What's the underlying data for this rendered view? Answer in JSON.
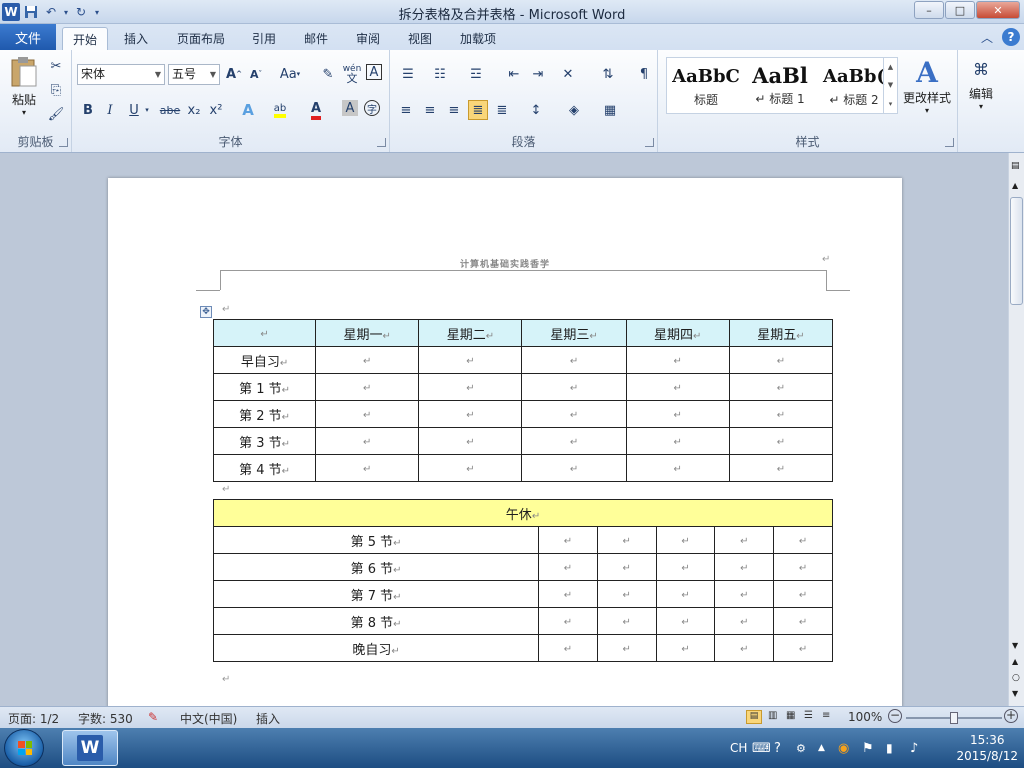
{
  "window": {
    "title": "拆分表格及合并表格 - Microsoft Word",
    "controls": {
      "minimize": "–",
      "maximize": "□",
      "close": "✕"
    }
  },
  "quick_access": {
    "app_icon": "W",
    "save_icon": "floppy-disk-icon",
    "undo_icon": "undo-icon",
    "redo_icon": "redo-icon"
  },
  "tabs": {
    "file": "文件",
    "items": [
      "开始",
      "插入",
      "页面布局",
      "引用",
      "邮件",
      "审阅",
      "视图",
      "加载项"
    ],
    "active": "开始"
  },
  "ribbon": {
    "clipboard": {
      "label": "剪贴板",
      "paste": "粘贴"
    },
    "font": {
      "label": "字体",
      "font_name": "宋体",
      "font_size": "五号",
      "aa_label": "Aa",
      "bold": "B",
      "italic": "I",
      "underline": "U",
      "strike": "abe",
      "subscript": "x₂",
      "superscript": "x²",
      "wen": "wén",
      "wen_char": "文",
      "a_box": "A",
      "zi": "字"
    },
    "paragraph": {
      "label": "段落"
    },
    "styles": {
      "label": "样式",
      "items": [
        {
          "sample": "AaBbC",
          "name": "标题"
        },
        {
          "sample": "AaBl",
          "name": "↵ 标题 1"
        },
        {
          "sample": "AaBb(",
          "name": "↵ 标题 2"
        }
      ],
      "change_styles": "更改样式"
    },
    "editing": {
      "label": "编辑"
    }
  },
  "document": {
    "header_text": "计算机基础实践香学",
    "return_mark": "↵",
    "table1": {
      "columns": [
        "",
        "星期一",
        "星期二",
        "星期三",
        "星期四",
        "星期五"
      ],
      "rows": [
        "早自习",
        "第 1 节",
        "第 2 节",
        "第 3 节",
        "第 4 节"
      ],
      "header_color": "#d6f3f9"
    },
    "table2": {
      "merged": "午休",
      "merged_color": "#ffff99",
      "rows": [
        "第 5 节",
        "第 6 节",
        "第 7 节",
        "第 8 节",
        "晚自习"
      ]
    }
  },
  "statusbar": {
    "page": "页面: 1/2",
    "words": "字数: 530",
    "language": "中文(中国)",
    "mode": "插入",
    "zoom": "100%",
    "zoom_level": 100
  },
  "taskbar": {
    "ime": "CH",
    "time": "15:36",
    "date": "2015/8/12"
  }
}
